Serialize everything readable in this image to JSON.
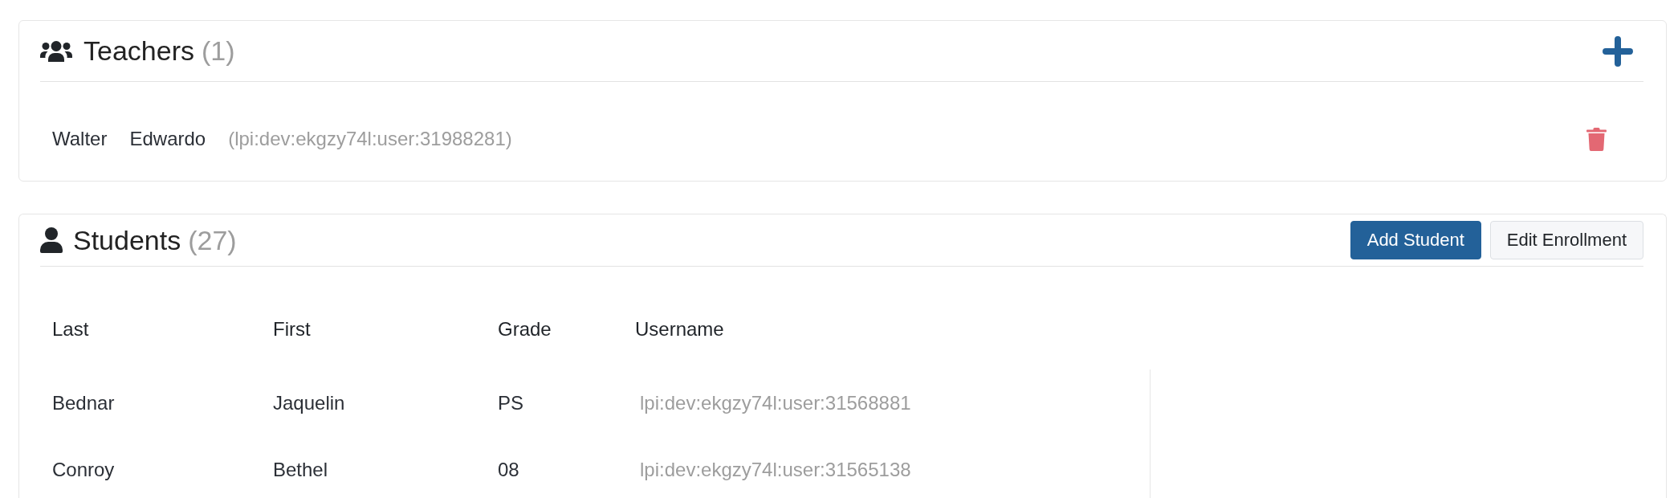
{
  "teachers": {
    "title": "Teachers",
    "count": "(1)",
    "rows": [
      {
        "first": "Walter",
        "last": "Edwardo",
        "username": "(lpi:dev:ekgzy74l:user:31988281)"
      }
    ]
  },
  "students": {
    "title": "Students",
    "count": "(27)",
    "buttons": [
      {
        "label": "Add Student",
        "kind": "primary"
      },
      {
        "label": "Edit Enrollment",
        "kind": "secondary"
      }
    ],
    "table": {
      "columns": [
        "Last",
        "First",
        "Grade",
        "Username"
      ],
      "rows": [
        {
          "last": "Bednar",
          "first": "Jaquelin",
          "grade": "PS",
          "username": "lpi:dev:ekgzy74l:user:31568881"
        },
        {
          "last": "Conroy",
          "first": "Bethel",
          "grade": "08",
          "username": "lpi:dev:ekgzy74l:user:31565138"
        }
      ]
    }
  }
}
